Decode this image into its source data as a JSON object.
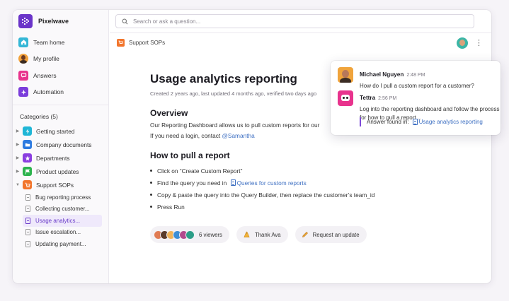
{
  "app": {
    "name": "Pixelwave",
    "brand_color": "#6a34c9"
  },
  "nav": [
    {
      "label": "Team home",
      "icon": "home-icon",
      "color": "#35b7d6"
    },
    {
      "label": "My profile",
      "icon": "avatar",
      "color": "#f2a23c"
    },
    {
      "label": "Answers",
      "icon": "chat-icon",
      "color": "#e8338d"
    },
    {
      "label": "Automation",
      "icon": "sparkle-icon",
      "color": "#7b3ddb"
    }
  ],
  "categories": {
    "title": "Categories (5)",
    "items": [
      {
        "label": "Getting started",
        "icon": "bolt-icon",
        "color": "#1fb6d6"
      },
      {
        "label": "Company documents",
        "icon": "folder-icon",
        "color": "#2d7ae0"
      },
      {
        "label": "Departments",
        "icon": "star-icon",
        "color": "#8a3ee0"
      },
      {
        "label": "Product updates",
        "icon": "flag-icon",
        "color": "#2cb34d"
      },
      {
        "label": "Support SOPs",
        "icon": "cart-icon",
        "color": "#f2752c"
      }
    ],
    "support_sops": [
      "Bug reporting process",
      "Collecting customer...",
      "Usage analytics...",
      "Issue escalation...",
      "Updating payment..."
    ]
  },
  "search": {
    "placeholder": "Search or ask a question..."
  },
  "breadcrumb": "Support SOPs",
  "document": {
    "title": "Usage analytics reporting",
    "meta": "Created 2 years ago, last updated 4 months ago, verified two days ago",
    "overview_heading": "Overview",
    "overview_text": "Our Reporting Dashboard allows us to pull custom reports for our",
    "login_text": "If you need a login, contact ",
    "login_link": "@Samantha",
    "howto_heading": "How to pull a report",
    "step1": "Click on “Create Custom Report”",
    "step2_prefix": "Find the query you need in ",
    "step2_link": "Queries for custom reports",
    "step3": "Copy & paste the query into the Query Builder, then replace the customer’s team_id",
    "step4": "Press Run"
  },
  "footer": {
    "viewers": "6 viewers",
    "thank": "Thank Ava",
    "request": "Request an update"
  },
  "chat": {
    "m1_name": "Michael Nguyen",
    "m1_time": "2:48 PM",
    "m1_text": "How do I pull a custom report for a customer?",
    "m2_name": "Tettra",
    "m2_time": "2:56 PM",
    "m2_text": "Log into the reporting dashboard and follow the process for how to pull a report...",
    "answer_label": "Answer found in:",
    "answer_link": "Usage analytics reporting"
  }
}
